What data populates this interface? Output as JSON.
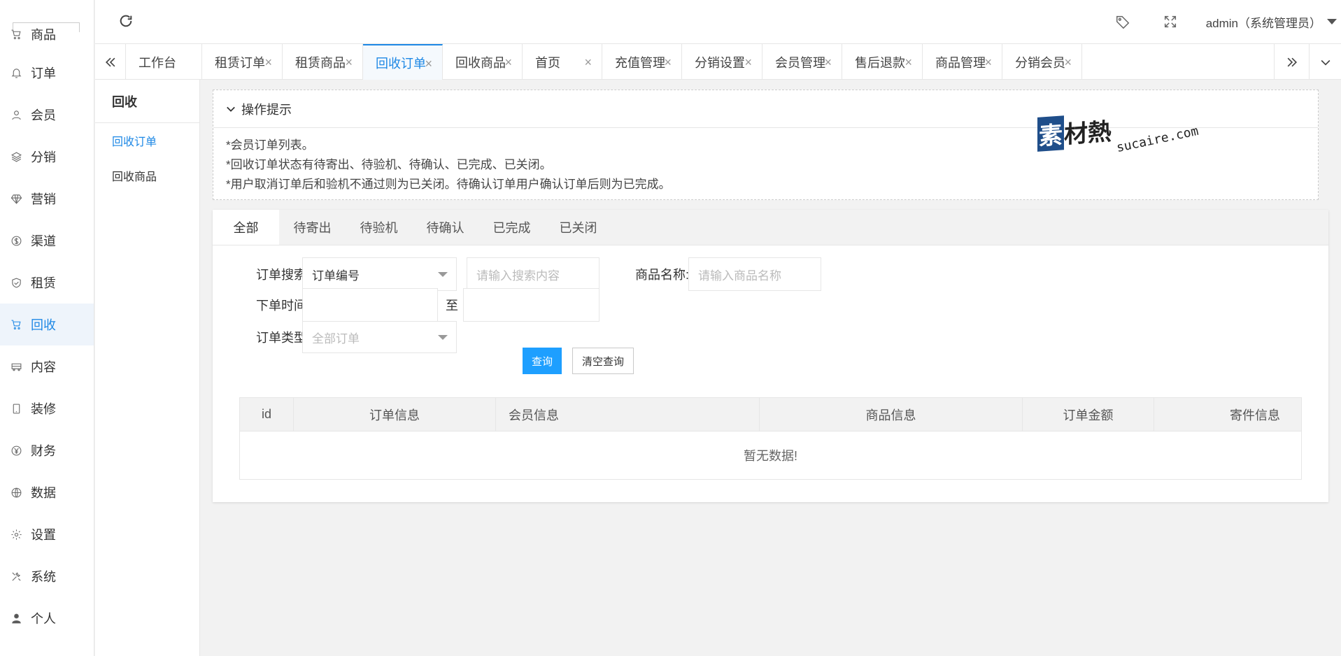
{
  "sidebar": {
    "items": [
      {
        "label": "商品",
        "icon": "cart-icon"
      },
      {
        "label": "订单",
        "icon": "bell-icon"
      },
      {
        "label": "会员",
        "icon": "user-icon"
      },
      {
        "label": "分销",
        "icon": "layers-icon"
      },
      {
        "label": "营销",
        "icon": "diamond-icon"
      },
      {
        "label": "渠道",
        "icon": "dollar-circle-icon"
      },
      {
        "label": "租赁",
        "icon": "shield-check-icon"
      },
      {
        "label": "回收",
        "icon": "cart-icon"
      },
      {
        "label": "内容",
        "icon": "bus-icon"
      },
      {
        "label": "装修",
        "icon": "tablet-icon"
      },
      {
        "label": "财务",
        "icon": "yen-circle-icon"
      },
      {
        "label": "数据",
        "icon": "globe-icon"
      },
      {
        "label": "设置",
        "icon": "gear-icon"
      },
      {
        "label": "系统",
        "icon": "tools-icon"
      },
      {
        "label": "个人",
        "icon": "person-icon"
      }
    ],
    "active_index": 7
  },
  "header": {
    "user_label": "admin（系统管理员）"
  },
  "tabs": [
    {
      "label": "工作台",
      "closable": false
    },
    {
      "label": "租赁订单",
      "closable": true
    },
    {
      "label": "租赁商品",
      "closable": true
    },
    {
      "label": "回收订单",
      "closable": true
    },
    {
      "label": "回收商品",
      "closable": true
    },
    {
      "label": "首页",
      "closable": true
    },
    {
      "label": "充值管理",
      "closable": true
    },
    {
      "label": "分销设置",
      "closable": true
    },
    {
      "label": "会员管理",
      "closable": true
    },
    {
      "label": "售后退款",
      "closable": true
    },
    {
      "label": "商品管理",
      "closable": true
    },
    {
      "label": "分销会员",
      "closable": true
    }
  ],
  "active_tab": 3,
  "tab_close_symbol": "×",
  "submenu": {
    "title": "回收",
    "items": [
      "回收订单",
      "回收商品"
    ]
  },
  "notice": {
    "title": "操作提示",
    "lines": [
      "*会员订单列表。",
      "*回收订单状态有待寄出、待验机、待确认、已完成、已关闭。",
      "*用户取消订单后和验机不通过则为已关闭。待确认订单用户确认订单后则为已完成。"
    ],
    "watermark_cn": "素材熱",
    "watermark_url": "sucaire.com"
  },
  "status_tabs": [
    "全部",
    "待寄出",
    "待验机",
    "待确认",
    "已完成",
    "已关闭"
  ],
  "form": {
    "search_label": "订单搜索:",
    "search_type_value": "订单编号",
    "search_placeholder": "请输入搜索内容",
    "goods_label": "商品名称:",
    "goods_placeholder": "请输入商品名称",
    "time_label": "下单时间:",
    "time_sep": "至",
    "type_label": "订单类型:",
    "type_value": "全部订单",
    "query_button": "查询",
    "clear_button": "清空查询"
  },
  "table": {
    "columns": [
      "id",
      "订单信息",
      "会员信息",
      "商品信息",
      "订单金额",
      "寄件信息"
    ],
    "empty_text": "暂无数据!"
  },
  "colors": {
    "accent": "#1e88e5",
    "button_primary": "#1e9fff"
  }
}
